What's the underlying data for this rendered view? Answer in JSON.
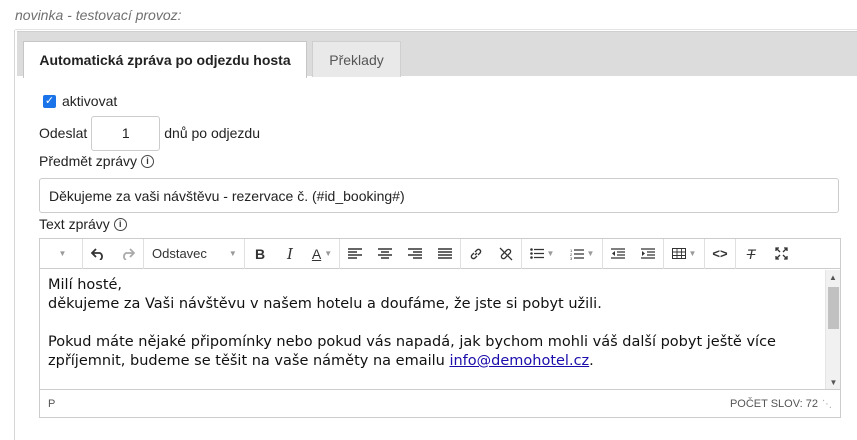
{
  "section_note": "novinka - testovací provoz:",
  "tabs": [
    {
      "label": "Automatická zpráva po odjezdu hosta",
      "active": true
    },
    {
      "label": "Překlady",
      "active": false
    }
  ],
  "form": {
    "activate_label": "aktivovat",
    "activate_checked": true,
    "send_label": "Odeslat",
    "days_value": "1",
    "days_suffix": "dnů po odjezdu",
    "subject_label": "Předmět zprávy",
    "subject_value": "Děkujeme za vaši návštěvu - rezervace č. (#id_booking#)",
    "text_label": "Text zprávy",
    "info_icon_glyph": "i"
  },
  "editor": {
    "block_format": "Odstavec",
    "toolbar_icons": [
      "undo-icon",
      "redo-icon",
      "bold-icon",
      "italic-icon",
      "text-color-icon",
      "align-left-icon",
      "align-center-icon",
      "align-right-icon",
      "align-justify-icon",
      "link-icon",
      "unlink-icon",
      "bullet-list-icon",
      "numbered-list-icon",
      "outdent-icon",
      "indent-icon",
      "table-icon",
      "source-code-icon",
      "clear-format-icon",
      "fullscreen-icon"
    ],
    "content": {
      "line1": "Milí hosté,",
      "line2": "děkujeme za Vaši návštěvu v našem hotelu a doufáme, že jste si pobyt užili.",
      "line3": "Pokud máte nějaké připomínky nebo pokud vás napadá, jak bychom mohli váš další pobyt ještě více",
      "line4_prefix": "zpříjemnit, budeme se těšit na vaše náměty na emailu ",
      "email": "info@demohotel.cz",
      "line4_suffix": "."
    },
    "status_path": "P",
    "word_count_label": "POČET SLOV: 72"
  },
  "colors": {
    "checkbox": "#1a73e8",
    "link": "#1a0dab",
    "tabbar_bg": "#dcdcdc"
  }
}
